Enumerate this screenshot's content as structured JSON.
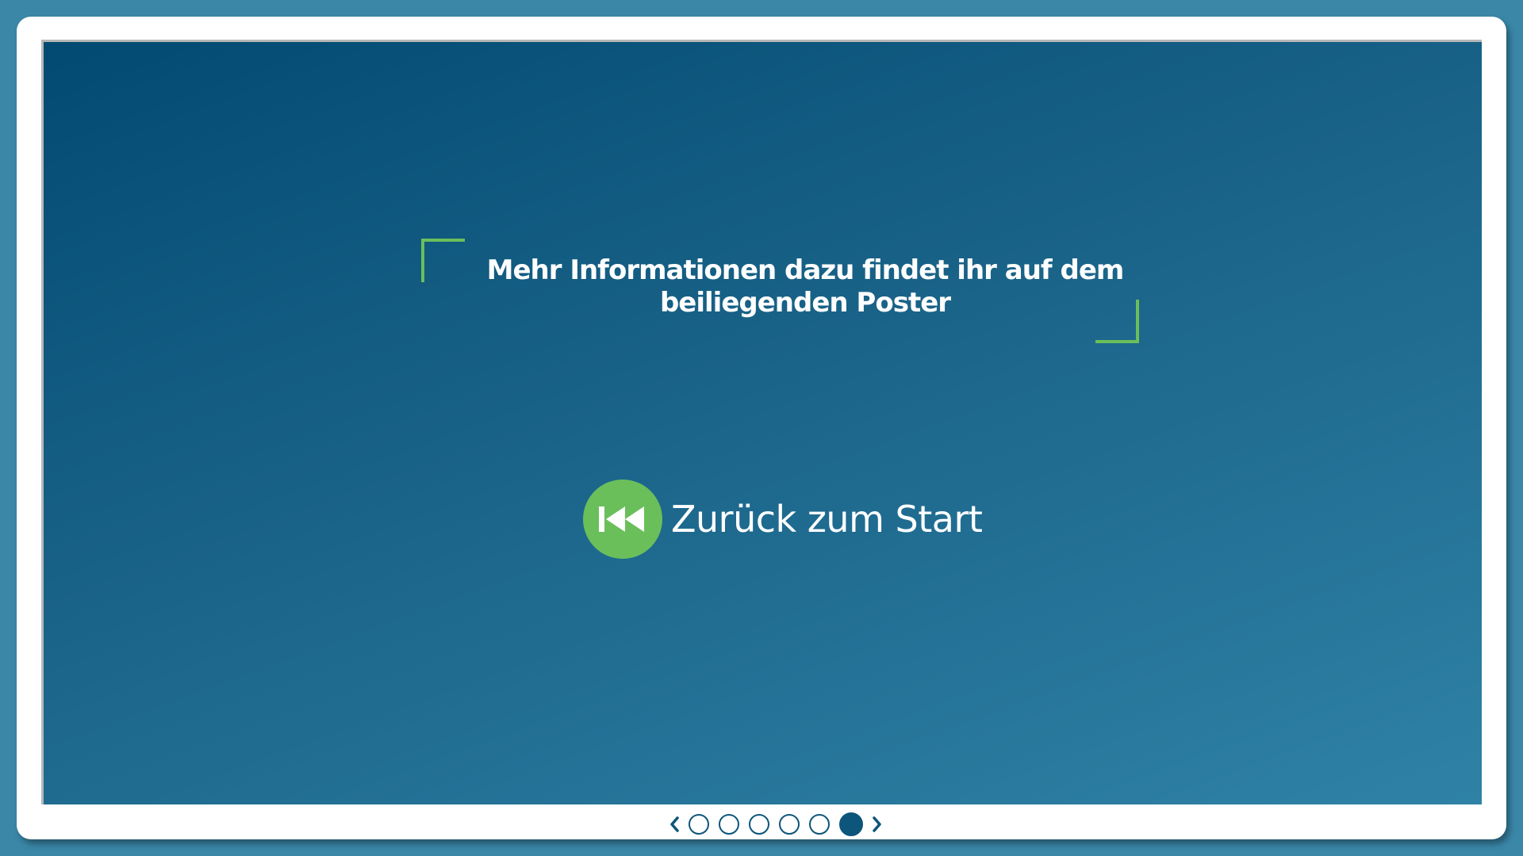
{
  "slide": {
    "info_text_line1": "Mehr Informationen dazu findet ihr auf dem",
    "info_text_line2": "beiliegenden Poster",
    "restart_label": "Zurück zum Start"
  },
  "pager": {
    "total": 6,
    "current": 6
  },
  "icons": {
    "restart": "rewind-to-start-icon",
    "prev": "chevron-left-icon",
    "next": "chevron-right-icon"
  },
  "colors": {
    "accent": "#6abf5b",
    "bg_dark": "#024a72",
    "bg_light": "#2f82a6",
    "pager": "#0d557b",
    "frame_background": "#3a87a8"
  }
}
